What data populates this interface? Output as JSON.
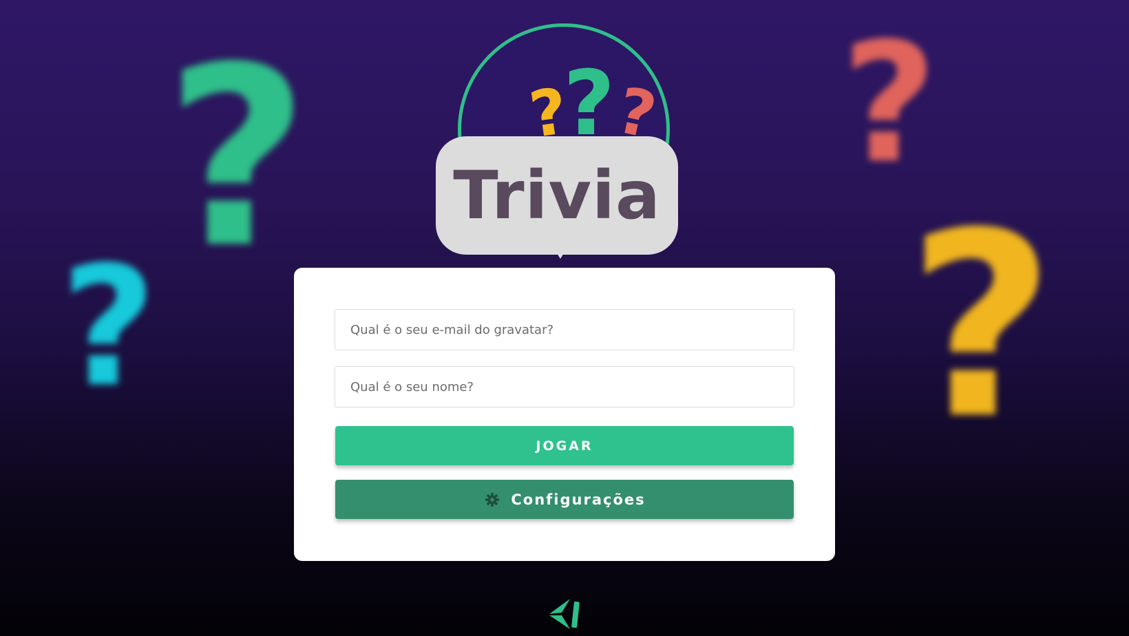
{
  "background": {
    "decorations": [
      {
        "name": "question-mark-green",
        "glyph": "?",
        "color": "#2fbf8a"
      },
      {
        "name": "question-mark-cyan",
        "glyph": "?",
        "color": "#17c9da"
      },
      {
        "name": "question-mark-red",
        "glyph": "?",
        "color": "#e0645c"
      },
      {
        "name": "question-mark-yellow",
        "glyph": "?",
        "color": "#f0b51f"
      }
    ]
  },
  "logo": {
    "title": "Trivia",
    "marks": [
      "?",
      "?",
      "?"
    ]
  },
  "form": {
    "email_placeholder": "Qual é o seu e-mail do gravatar?",
    "name_placeholder": "Qual é o seu nome?",
    "play_label": "JOGAR",
    "settings_label": "Configurações",
    "settings_icon": "gear-icon"
  },
  "footer": {
    "brand_icon": "brand-logo-icon"
  },
  "colors": {
    "accent": "#2fc28e",
    "accent_dark": "#348f6f",
    "title_text": "#5a4a5d",
    "badge_bg": "#dcdcdd"
  }
}
